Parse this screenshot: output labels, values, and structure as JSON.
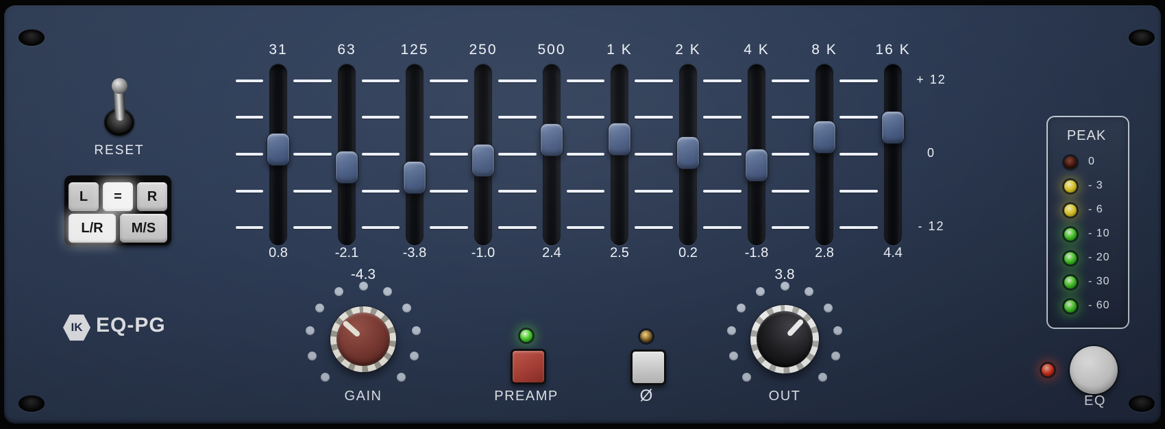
{
  "device": {
    "brand_mark": "IK",
    "model": "EQ-PG"
  },
  "colors": {
    "panel": "#2f3e59",
    "tick": "#edf1f7",
    "text": "#eef2f8",
    "gain_knob_face": "#7c3a33",
    "out_knob_face": "#1d1d20",
    "preamp_button": "#ad4238",
    "led_green": "#4fd42c",
    "led_yellow": "#e6cf2a",
    "led_red": "#e23a20"
  },
  "reset": {
    "label": "RESET"
  },
  "channel_matrix": {
    "rows": [
      [
        {
          "label": "L",
          "lit": false
        },
        {
          "label": "=",
          "lit": true
        },
        {
          "label": "R",
          "lit": false
        }
      ],
      [
        {
          "label": "L/R",
          "lit": true
        },
        {
          "label": "M/S",
          "lit": false
        }
      ]
    ]
  },
  "eq": {
    "range_db": [
      -12,
      12
    ],
    "scale_labels": [
      {
        "text": "+ 12",
        "db": 12
      },
      {
        "text": "0",
        "db": 0
      },
      {
        "text": "- 12",
        "db": -12
      }
    ],
    "bands": [
      {
        "freq": "31",
        "value": "0.8"
      },
      {
        "freq": "63",
        "value": "-2.1"
      },
      {
        "freq": "125",
        "value": "-3.8"
      },
      {
        "freq": "250",
        "value": "-1.0"
      },
      {
        "freq": "500",
        "value": "2.4"
      },
      {
        "freq": "1 K",
        "value": "2.5"
      },
      {
        "freq": "2 K",
        "value": "0.2"
      },
      {
        "freq": "4 K",
        "value": "-1.8"
      },
      {
        "freq": "8 K",
        "value": "2.8"
      },
      {
        "freq": "16 K",
        "value": "4.4"
      }
    ]
  },
  "gain": {
    "label": "GAIN",
    "value": "-4.3"
  },
  "preamp": {
    "label": "PREAMP",
    "led_lit": true
  },
  "phase": {
    "label": "Ø",
    "led_lit": false
  },
  "out": {
    "label": "OUT",
    "value": "3.8"
  },
  "peak_meter": {
    "title": "PEAK",
    "leds": [
      {
        "label": "0",
        "color": "red",
        "lit": false
      },
      {
        "label": "- 3",
        "color": "yellow",
        "lit": true
      },
      {
        "label": "- 6",
        "color": "yellow",
        "lit": true
      },
      {
        "label": "- 10",
        "color": "green",
        "lit": true
      },
      {
        "label": "- 20",
        "color": "green",
        "lit": true
      },
      {
        "label": "- 30",
        "color": "green",
        "lit": true
      },
      {
        "label": "- 60",
        "color": "green",
        "lit": true
      }
    ]
  },
  "eq_bypass": {
    "label": "EQ",
    "led_lit": true
  }
}
